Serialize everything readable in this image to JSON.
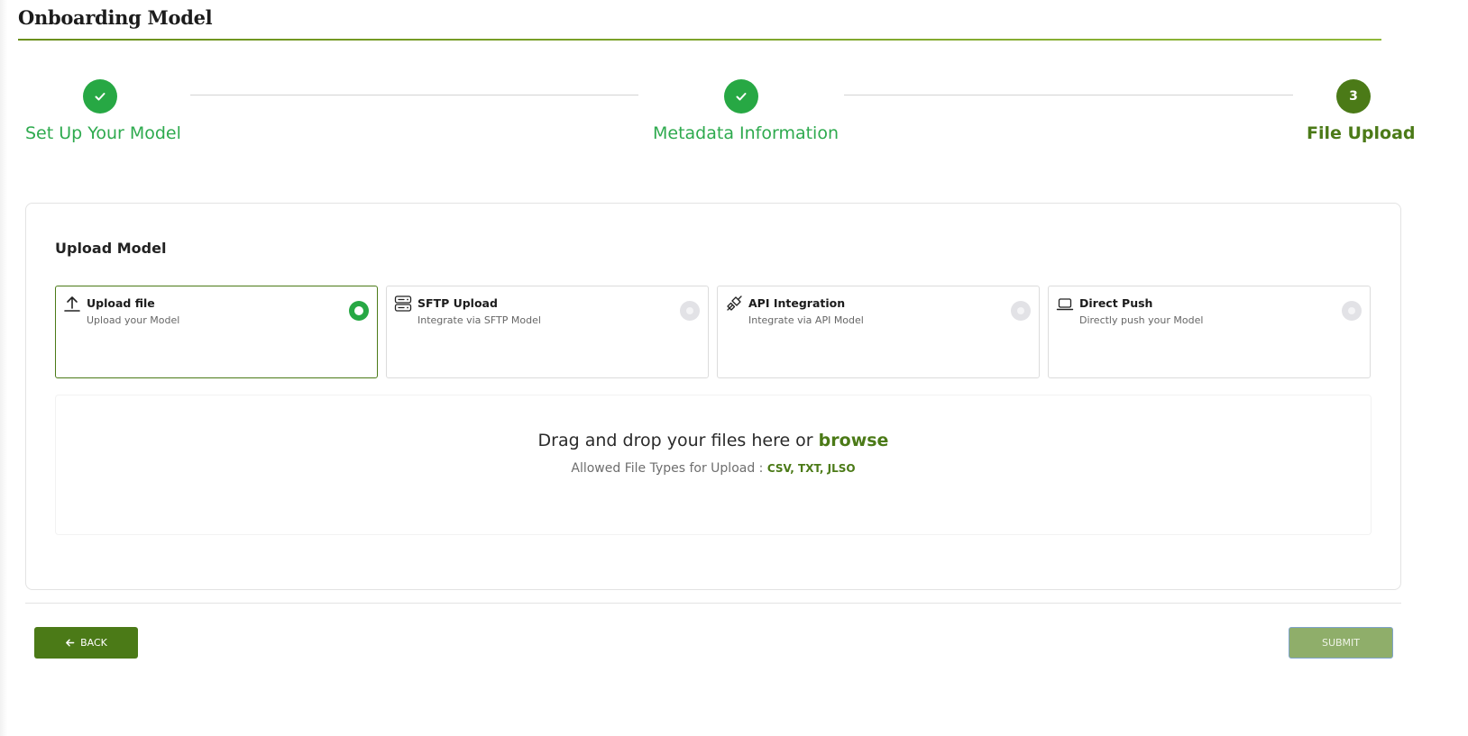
{
  "page": {
    "title": "Onboarding Model"
  },
  "stepper": {
    "steps": [
      {
        "label": "Set Up Your Model",
        "status": "done"
      },
      {
        "label": "Metadata Information",
        "status": "done"
      },
      {
        "label": "File Upload",
        "status": "active",
        "number": "3"
      }
    ]
  },
  "upload": {
    "title": "Upload Model",
    "options": [
      {
        "title": "Upload file",
        "subtitle": "Upload your Model",
        "icon": "upload-arrow-icon",
        "selected": true
      },
      {
        "title": "SFTP Upload",
        "subtitle": "Integrate via SFTP Model",
        "icon": "server-icon",
        "selected": false
      },
      {
        "title": "API Integration",
        "subtitle": "Integrate via API Model",
        "icon": "plug-icon",
        "selected": false
      },
      {
        "title": "Direct Push",
        "subtitle": "Directly push your Model",
        "icon": "laptop-icon",
        "selected": false
      }
    ],
    "dropzone": {
      "text": "Drag and drop your files here or",
      "browse": "browse",
      "allowed_label": "Allowed File Types for Upload :",
      "allowed_types": "CSV, TXT, JLSO"
    }
  },
  "actions": {
    "back": "BACK",
    "submit": "SUBMIT"
  },
  "colors": {
    "brand": "#4b7a17",
    "success": "#27a844",
    "submit_disabled": "#8fae6a"
  }
}
